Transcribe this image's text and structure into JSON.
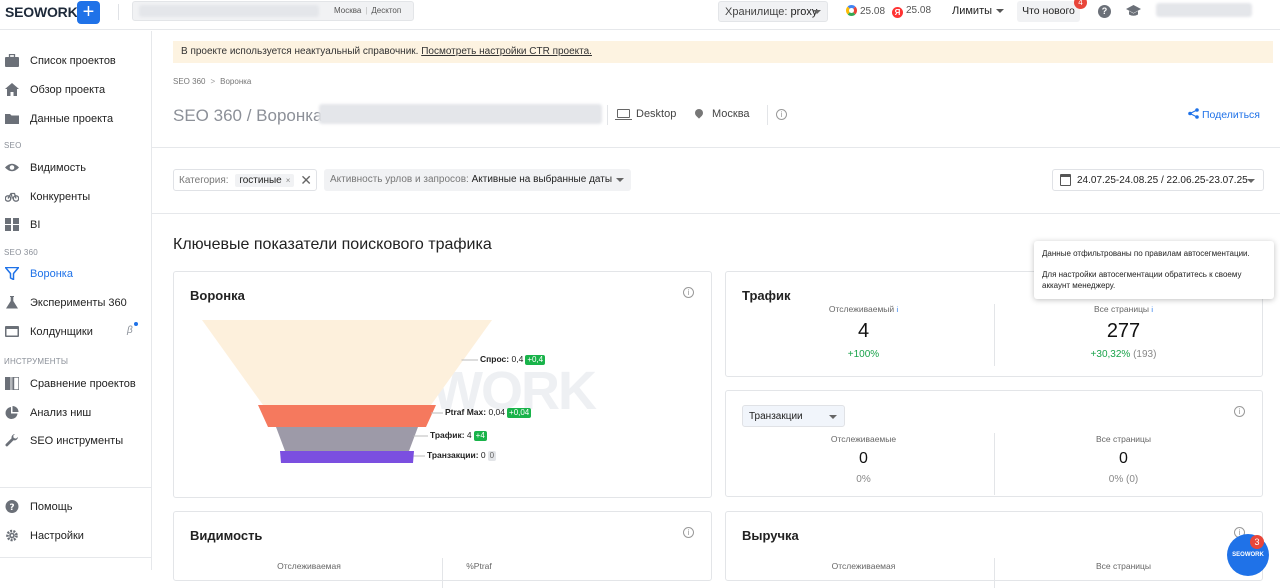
{
  "topbar": {
    "logo": "SEOWORK",
    "add_label": "+",
    "region": "Москва",
    "device": "Десктоп",
    "storage_label": "Хранилище:",
    "storage_value": "proxy",
    "google_date": "25.08",
    "yandex_date": "25.08",
    "yandex_icon_letter": "Я",
    "limits_label": "Лимиты",
    "whats_new_label": "Что нового",
    "whats_new_count": "4",
    "help_glyph": "?"
  },
  "sidebar": {
    "items_main": [
      {
        "label": "Список проектов",
        "icon": "briefcase-icon"
      },
      {
        "label": "Обзор проекта",
        "icon": "home-icon"
      },
      {
        "label": "Данные проекта",
        "icon": "folder-icon"
      }
    ],
    "section_seo": "SEO",
    "items_seo": [
      {
        "label": "Видимость",
        "icon": "eye-icon"
      },
      {
        "label": "Конкуренты",
        "icon": "bicycle-icon"
      },
      {
        "label": "BI",
        "icon": "grid-icon"
      }
    ],
    "section_seo360": "SEO 360",
    "items_seo360": [
      {
        "label": "Воронка",
        "icon": "funnel-icon"
      },
      {
        "label": "Эксперименты 360",
        "icon": "flask-icon"
      },
      {
        "label": "Колдунщики",
        "icon": "window-icon"
      }
    ],
    "beta_label": "β",
    "section_tools": "ИНСТРУМЕНТЫ",
    "items_tools": [
      {
        "label": "Сравнение проектов",
        "icon": "compare-icon"
      },
      {
        "label": "Анализ ниш",
        "icon": "pie-icon"
      },
      {
        "label": "SEO инструменты",
        "icon": "wrench-icon"
      }
    ],
    "help_label": "Помощь",
    "settings_label": "Настройки"
  },
  "banner": {
    "text": "В проекте используется неактуальный справочник. ",
    "link": "Посмотреть настройки CTR проекта."
  },
  "breadcrumbs": {
    "root": "SEO 360",
    "sep": ">",
    "current": "Воронка"
  },
  "header": {
    "title": "SEO 360 / Воронка:",
    "device": "Desktop",
    "region": "Москва",
    "share_label": "Поделиться"
  },
  "filters": {
    "category_label": "Категория:",
    "category_value": "гостиные",
    "chip_close": "×",
    "clear_glyph": "✕",
    "activity_label": "Активность урлов и запросов:",
    "activity_value": "Активные на выбранные даты",
    "date_range": "24.07.25-24.08.25 / 22.06.25-23.07.25"
  },
  "section_title": "Ключевые показатели поискового трафика",
  "info_glyph": "i",
  "funnel_card": {
    "title": "Воронка",
    "watermark": "WORK",
    "stages": [
      {
        "name": "Спрос:",
        "value": "0,4",
        "delta": "+0,4",
        "delta_tone": "green",
        "color": "#fdf0dc",
        "share": 1.0
      },
      {
        "name": "Ptraf Max:",
        "value": "0,04",
        "delta": "+0,04",
        "delta_tone": "green",
        "color": "#f5795e",
        "share": 0.58
      },
      {
        "name": "Трафик:",
        "value": "4",
        "delta": "+4",
        "delta_tone": "green",
        "color": "#9d9aa8",
        "share": 0.46
      },
      {
        "name": "Транзакции:",
        "value": "0",
        "delta": "0",
        "delta_tone": "neutral",
        "color": "#7b4fe0",
        "share": 0.45
      }
    ]
  },
  "traffic_card": {
    "title": "Трафик",
    "tracked_label": "Отслеживаемый",
    "tracked_value": "4",
    "tracked_delta": "+100%",
    "all_label": "Все страницы",
    "all_value": "277",
    "all_delta": "+30,32%",
    "all_delta_abs": "(193)"
  },
  "transactions_card": {
    "select_value": "Транзакции",
    "tracked_label": "Отслеживаемые",
    "tracked_value": "0",
    "tracked_delta": "0%",
    "all_label": "Все страницы",
    "all_value": "0",
    "all_delta": "0% (0)"
  },
  "visibility_card": {
    "title": "Видимость",
    "tracked_label": "Отслеживаемая",
    "ptraf_label": "%Ptraf"
  },
  "revenue_card": {
    "title": "Выручка",
    "tracked_label": "Отслеживаемая",
    "all_label": "Все страницы"
  },
  "tooltip": {
    "line1": "Данные отфильтрованы по правилам автосегментации.",
    "line2": "Для настройки автосегментации обратитесь к своему аккаунт менеджеру."
  },
  "chat": {
    "label": "SEOWORK",
    "count": "3"
  }
}
